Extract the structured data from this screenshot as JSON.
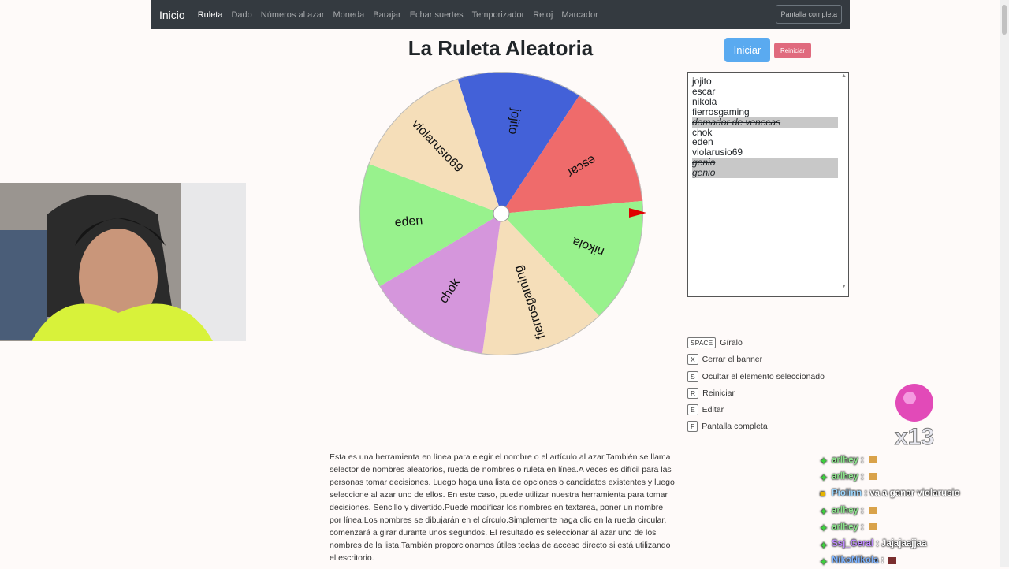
{
  "navbar": {
    "brand": "Inicio",
    "items": [
      {
        "label": "Ruleta",
        "active": true
      },
      {
        "label": "Dado",
        "active": false
      },
      {
        "label": "Números al azar",
        "active": false
      },
      {
        "label": "Moneda",
        "active": false
      },
      {
        "label": "Barajar",
        "active": false
      },
      {
        "label": "Echar suertes",
        "active": false
      },
      {
        "label": "Temporizador",
        "active": false
      },
      {
        "label": "Reloj",
        "active": false
      },
      {
        "label": "Marcador",
        "active": false
      }
    ],
    "fullscreen_label": "Pantalla completa"
  },
  "page_title": "La Ruleta Aleatoria",
  "controls": {
    "start_label": "Iniciar",
    "reset_label": "Reiniciar"
  },
  "names_list": [
    {
      "name": "jojito",
      "hidden": false
    },
    {
      "name": "escar",
      "hidden": false
    },
    {
      "name": "nikola",
      "hidden": false
    },
    {
      "name": "fierrosgaming",
      "hidden": false
    },
    {
      "name": "domador de venecas",
      "hidden": true
    },
    {
      "name": "chok",
      "hidden": false
    },
    {
      "name": "eden",
      "hidden": false
    },
    {
      "name": "violarusio69",
      "hidden": false
    },
    {
      "name": "genio",
      "hidden": true
    },
    {
      "name": "genio",
      "hidden": true
    }
  ],
  "wheel": {
    "segments": [
      {
        "label": "jojito",
        "color": "#4361d8"
      },
      {
        "label": "escar",
        "color": "#ef6b6b"
      },
      {
        "label": "nikola",
        "color": "#98f28d"
      },
      {
        "label": "fierrosgaming",
        "color": "#f5deb9"
      },
      {
        "label": "chok",
        "color": "#d596dc"
      },
      {
        "label": "eden",
        "color": "#98f28d"
      },
      {
        "label": "violarusio69",
        "color": "#f5deb9"
      }
    ],
    "pointer_color": "#e00000"
  },
  "shortcuts": [
    {
      "key": "SPACE",
      "label": "Gíralo"
    },
    {
      "key": "X",
      "label": "Cerrar el banner"
    },
    {
      "key": "S",
      "label": "Ocultar el elemento seleccionado"
    },
    {
      "key": "R",
      "label": "Reiniciar"
    },
    {
      "key": "E",
      "label": "Editar"
    },
    {
      "key": "F",
      "label": "Pantalla completa"
    }
  ],
  "description": "Esta es una herramienta en línea para elegir el nombre o el artículo al azar.También se llama selector de nombres aleatorios, rueda de nombres o ruleta en línea.A veces es difícil para las personas tomar decisiones. Luego haga una lista de opciones o candidatos existentes y luego seleccione al azar uno de ellos. En este caso, puede utilizar nuestra herramienta para tomar decisiones. Sencillo y divertido.Puede modificar los nombres en textarea, poner un nombre por línea.Los nombres se dibujarán en el círculo.Simplemente haga clic en la rueda circular, comenzará a girar durante unos segundos. El resultado es seleccionar al azar uno de los nombres de la lista.También proporcionamos útiles teclas de acceso directo si está utilizando el escritorio.",
  "overlay": {
    "badge_text": "x13",
    "chat": [
      {
        "user": "arlhey",
        "message": ""
      },
      {
        "user": "arlhey",
        "message": ""
      },
      {
        "user": "Piolinn",
        "message": "va a ganar violarusio"
      },
      {
        "user": "arlhey",
        "message": ""
      },
      {
        "user": "arlhey",
        "message": ""
      },
      {
        "user": "Ssj_Geral",
        "message": "Jajajaajjaa"
      },
      {
        "user": "NikoNikola",
        "message": ""
      }
    ]
  }
}
